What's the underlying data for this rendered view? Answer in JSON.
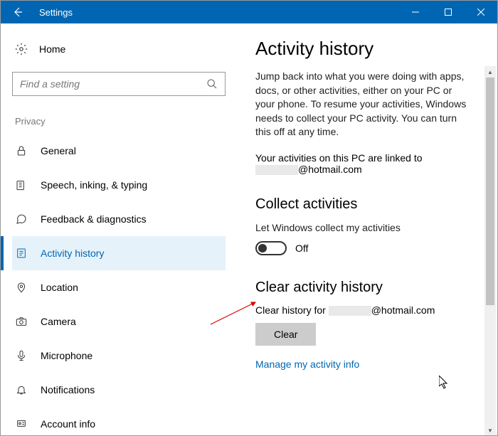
{
  "titlebar": {
    "title": "Settings"
  },
  "sidebar": {
    "home_label": "Home",
    "search_placeholder": "Find a setting",
    "section_label": "Privacy",
    "items": [
      {
        "icon": "lock",
        "label": "General"
      },
      {
        "icon": "keyboard",
        "label": "Speech, inking, & typing"
      },
      {
        "icon": "feedback",
        "label": "Feedback & diagnostics"
      },
      {
        "icon": "history",
        "label": "Activity history"
      },
      {
        "icon": "location",
        "label": "Location"
      },
      {
        "icon": "camera",
        "label": "Camera"
      },
      {
        "icon": "microphone",
        "label": "Microphone"
      },
      {
        "icon": "bell",
        "label": "Notifications"
      },
      {
        "icon": "account",
        "label": "Account info"
      }
    ]
  },
  "page": {
    "heading": "Activity history",
    "description": "Jump back into what you were doing with apps, docs, or other activities, either on your PC or your phone. To resume your activities, Windows needs to collect your PC activity. You can turn this off at any time.",
    "linked_prefix": "Your activities on this PC are linked to",
    "linked_email_suffix": "@hotmail.com",
    "collect": {
      "heading": "Collect activities",
      "desc": "Let Windows collect my activities",
      "state": "Off"
    },
    "clear": {
      "heading": "Clear activity history",
      "desc_prefix": "Clear history for",
      "desc_suffix": "@hotmail.com",
      "button": "Clear"
    },
    "manage_link": "Manage my activity info"
  }
}
